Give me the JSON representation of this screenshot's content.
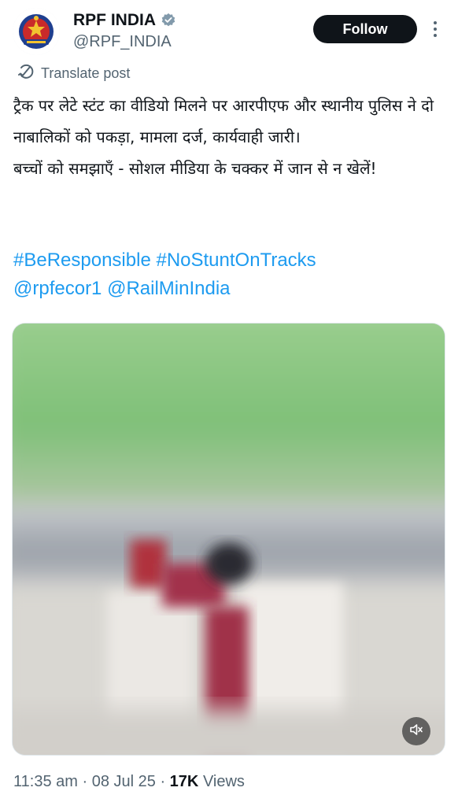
{
  "account": {
    "display_name": "RPF INDIA",
    "handle": "@RPF_INDIA",
    "verified": true,
    "follow_label": "Follow"
  },
  "translate": {
    "label": "Translate post"
  },
  "post": {
    "text_lines": [
      "ट्रैक पर लेटे स्टंट का वीडियो मिलने पर आरपीएफ और स्थानीय पुलिस ने दो नाबालिकों को पकड़ा, मामला दर्ज, कार्यवाही जारी।",
      "बच्चों को समझाएँ - सोशल मीडिया के चक्कर में जान से न खेलें!"
    ],
    "hashtags": [
      "#BeResponsible",
      "#NoStuntOnTracks"
    ],
    "mentions": [
      "@rpfecor1",
      "@RailMinIndia"
    ]
  },
  "media": {
    "type": "video",
    "muted": true
  },
  "meta": {
    "time": "11:35 am",
    "separator": "·",
    "date": "08 Jul 25",
    "views_count": "17K",
    "views_label": "Views"
  },
  "colors": {
    "link": "#1d9bf0",
    "text": "#0f1419",
    "secondary": "#536471",
    "verified_badge": "#829aab",
    "follow_bg": "#0f1419"
  },
  "icons": {
    "verified": "verified-badge-icon",
    "more": "more-vertical-icon",
    "translate": "translate-icon",
    "mute": "speaker-muted-icon"
  }
}
